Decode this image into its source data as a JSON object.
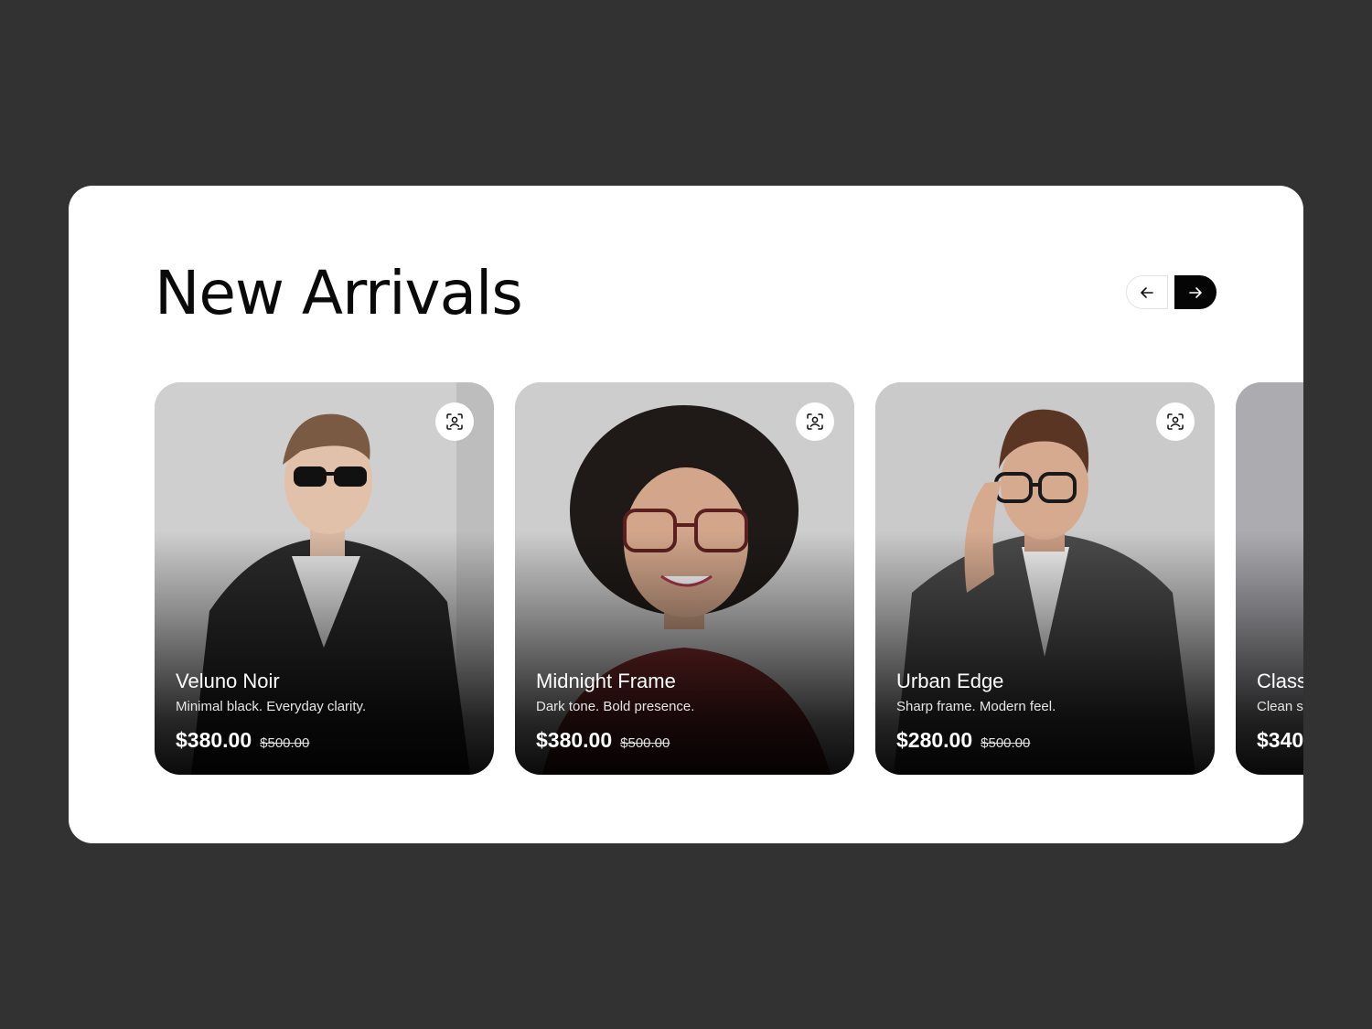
{
  "section": {
    "title": "New Arrivals"
  },
  "carousel": {
    "prev_icon": "arrow-left-icon",
    "next_icon": "arrow-right-icon"
  },
  "products": [
    {
      "name": "Veluno Noir",
      "description": "Minimal black. Everyday clarity.",
      "price": "$380.00",
      "old_price": "$500.00",
      "icon": "face-scan-icon"
    },
    {
      "name": "Midnight Frame",
      "description": "Dark tone. Bold presence.",
      "price": "$380.00",
      "old_price": "$500.00",
      "icon": "face-scan-icon"
    },
    {
      "name": "Urban Edge",
      "description": "Sharp frame. Modern feel.",
      "price": "$280.00",
      "old_price": "$500.00",
      "icon": "face-scan-icon"
    },
    {
      "name": "Class",
      "description": "Clean sh",
      "price": "$340",
      "old_price": "",
      "icon": ""
    }
  ],
  "colors": {
    "background": "#323232",
    "panel": "#ffffff",
    "accent_button": "#050505"
  }
}
